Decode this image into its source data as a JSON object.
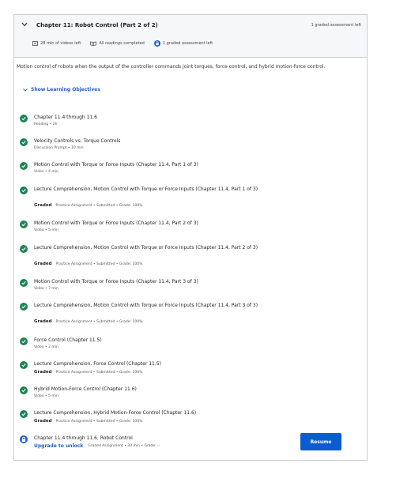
{
  "section": {
    "title": "Chapter 11: Robot Control (Part 2 of 2)",
    "graded_left": "1 graded assessment left",
    "meta": {
      "videos_left": "28 min of videos left",
      "readings": "All readings completed",
      "graded": "1 graded assessment left"
    },
    "intro": "Motion control of robots when the output of the controller commands joint torques, force control, and hybrid motion-force control.",
    "objectives_label": "Show Learning Objectives"
  },
  "items": [
    {
      "title": "Chapter 11.4 through 11.6",
      "sub": "Reading • 2h",
      "status": "completed"
    },
    {
      "title": "Velocity Controls vs. Torque Controls",
      "sub": "Discussion Prompt • 10 min",
      "status": "completed"
    },
    {
      "title": "Motion Control with Torque or Force Inputs (Chapter 11.4, Part 1 of 3)",
      "sub": "Video • 4 min",
      "status": "completed"
    },
    {
      "title": "Lecture Comprehension, Motion Control with Torque or Force Inputs (Chapter 11.4, Part 1 of 3)",
      "graded": "Graded",
      "sub": "Practice Assignment • Submitted • Grade: 100%",
      "status": "completed"
    },
    {
      "title": "Motion Control with Torque or Force Inputs (Chapter 11.4, Part 2 of 3)",
      "sub": "Video • 5 min",
      "status": "completed"
    },
    {
      "title": "Lecture Comprehension, Motion Control with Torque or Force Inputs (Chapter 11.4, Part 2 of 3)",
      "graded": "Graded",
      "sub": "Practice Assignment • Submitted • Grade: 100%",
      "status": "completed"
    },
    {
      "title": "Motion Control with Torque or Force Inputs (Chapter 11.4, Part 3 of 3)",
      "sub": "Video • 7 min",
      "status": "completed"
    },
    {
      "title": "Lecture Comprehension, Motion Control with Torque or Force Inputs (Chapter 11.4, Part 3 of 3)",
      "graded": "Graded",
      "sub": "Practice Assignment • Submitted • Grade: 100%",
      "status": "completed"
    },
    {
      "title": "Force Control (Chapter 11.5)",
      "sub": "Video • 2 min",
      "status": "completed"
    },
    {
      "title": "Lecture Comprehension, Force Control (Chapter 11.5)",
      "graded": "Graded",
      "sub": "Practice Assignment • Submitted • Grade: 100%",
      "status": "completed"
    },
    {
      "title": "Hybrid Motion-Force Control (Chapter 11.6)",
      "sub": "Video • 5 min",
      "status": "completed"
    },
    {
      "title": "Lecture Comprehension, Hybrid Motion-Force Control (Chapter 11.6)",
      "graded": "Graded",
      "sub": "Practice Assignment • Submitted • Grade: 100%",
      "status": "completed"
    },
    {
      "title": "Chapter 11.4 through 11.6, Robot Control",
      "upgrade": "Upgrade to unlock",
      "sub": "Graded Assignment • 30 min • Grade: --",
      "status": "locked"
    }
  ],
  "resume_label": "Resume",
  "colors": {
    "check": "#1f8354",
    "accent": "#1c5ec7",
    "button": "#0b5bd3"
  }
}
